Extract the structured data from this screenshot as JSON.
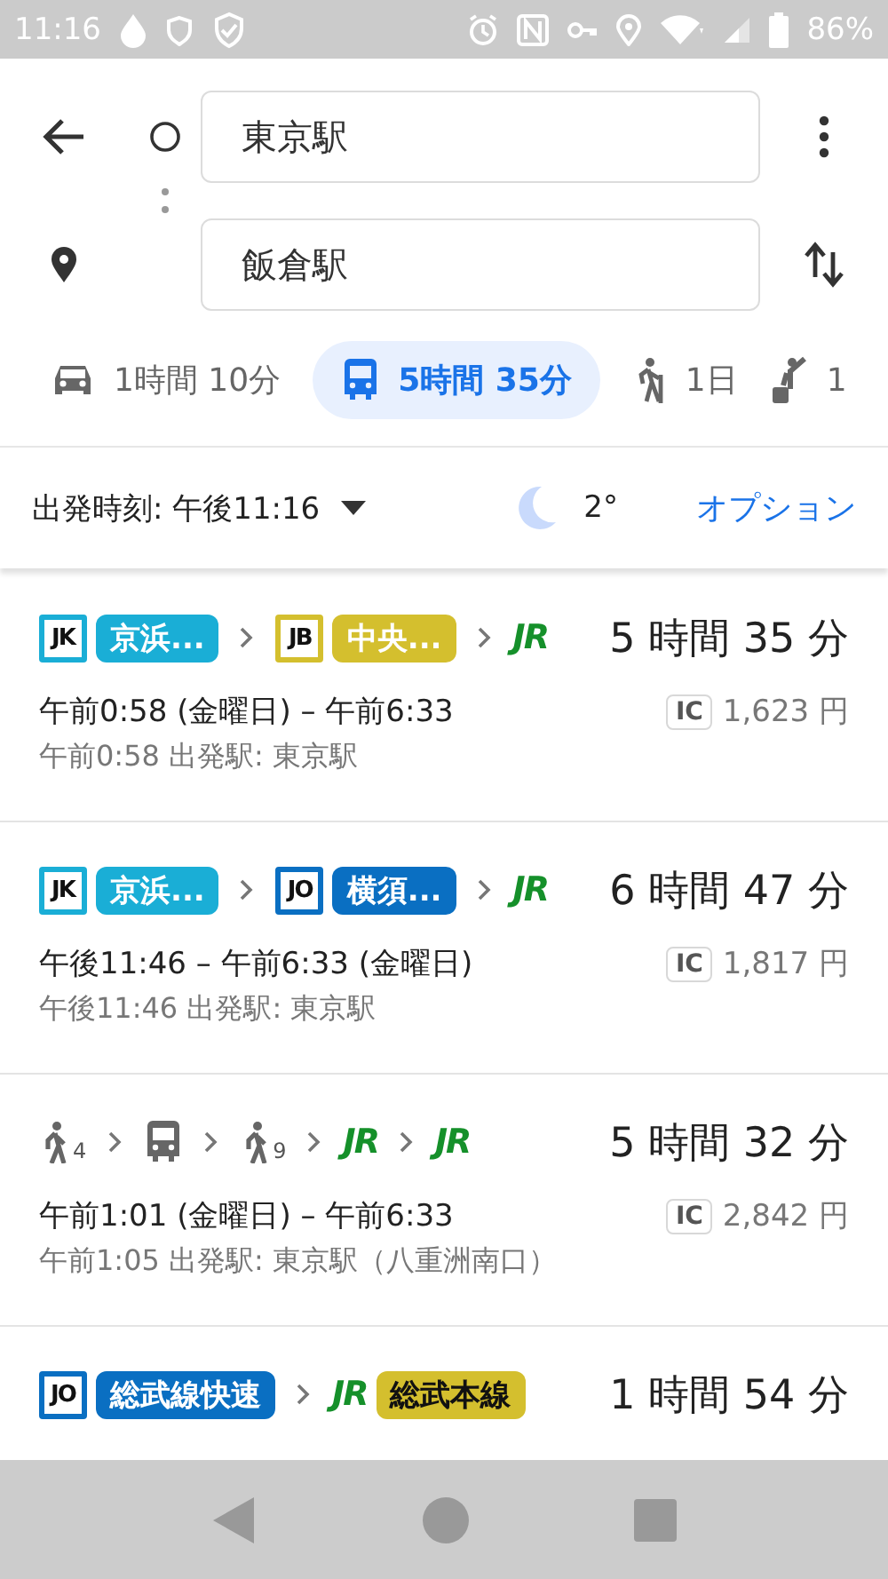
{
  "status_bar": {
    "time": "11:16",
    "battery": "86%"
  },
  "search": {
    "origin": "東京駅",
    "destination": "飯倉駅"
  },
  "modes": [
    {
      "kind": "car",
      "label": "1時間 10分",
      "selected": false
    },
    {
      "kind": "transit",
      "label": "5時間 35分",
      "selected": true
    },
    {
      "kind": "walk",
      "label": "1日",
      "selected": false
    },
    {
      "kind": "ride",
      "label": "1",
      "selected": false
    }
  ],
  "departure": {
    "label": "出発時刻: 午後11:16",
    "temperature": "2°",
    "options": "オプション"
  },
  "routes": [
    {
      "steps": [
        {
          "kind": "line",
          "code": "JK",
          "name": "京浜...",
          "color": "#1aaed6"
        },
        {
          "kind": "line",
          "code": "JB",
          "name": "中央...",
          "color": "#d4bf2e"
        },
        {
          "kind": "jr",
          "mark": "JR"
        }
      ],
      "duration": "5 時間 35 分",
      "times": "午前0:58 (金曜日) – 午前6:33",
      "card": "IC",
      "fare": "1,623 円",
      "depart": "午前0:58 出発駅: 東京駅"
    },
    {
      "steps": [
        {
          "kind": "line",
          "code": "JK",
          "name": "京浜...",
          "color": "#1aaed6"
        },
        {
          "kind": "line",
          "code": "JO",
          "name": "横須...",
          "color": "#0a6fc2"
        },
        {
          "kind": "jr",
          "mark": "JR"
        }
      ],
      "duration": "6 時間 47 分",
      "times": "午後11:46 – 午前6:33 (金曜日)",
      "card": "IC",
      "fare": "1,817 円",
      "depart": "午後11:46 出発駅: 東京駅"
    },
    {
      "steps": [
        {
          "kind": "walk",
          "sub": "4"
        },
        {
          "kind": "bus"
        },
        {
          "kind": "walk",
          "sub": "9"
        },
        {
          "kind": "jr",
          "mark": "JR"
        },
        {
          "kind": "jr",
          "mark": "JR"
        }
      ],
      "duration": "5 時間 32 分",
      "times": "午前1:01 (金曜日) – 午前6:33",
      "card": "IC",
      "fare": "2,842 円",
      "depart": "午前1:05 出発駅: 東京駅（八重洲南口）"
    },
    {
      "steps": [
        {
          "kind": "line",
          "code": "JO",
          "name": "総武線快速",
          "color": "#0a6fc2"
        },
        {
          "kind": "jr",
          "mark": "JR",
          "name": "総武本線",
          "color": "#d4bf2e"
        }
      ],
      "duration": "1 時間 54 分"
    }
  ]
}
